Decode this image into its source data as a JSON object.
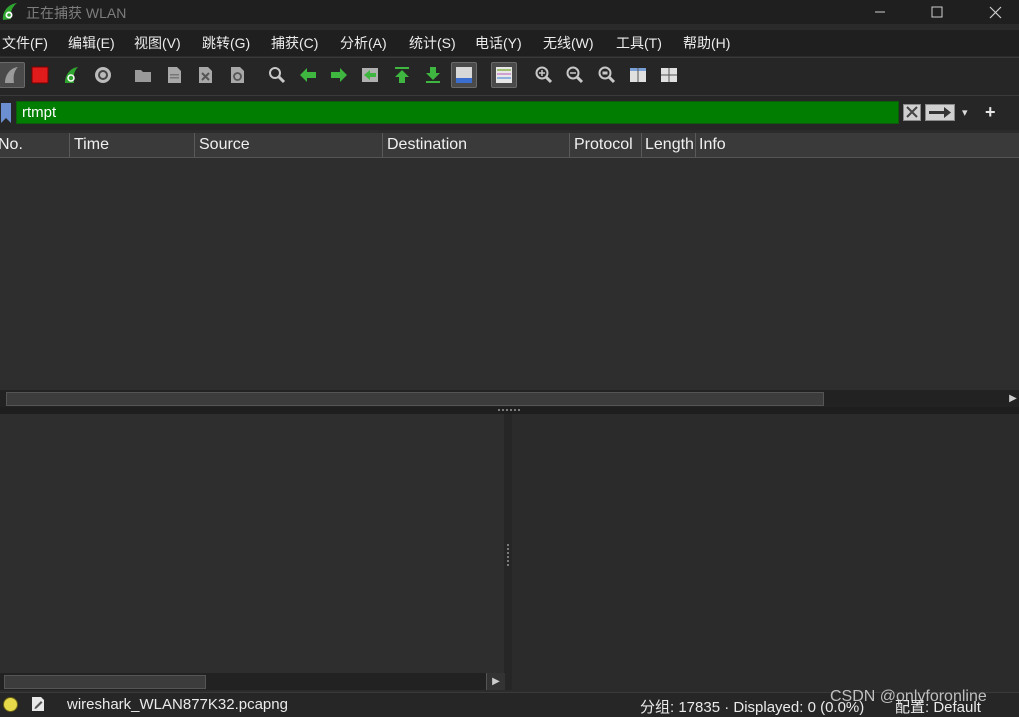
{
  "window": {
    "title": "正在捕获 WLAN"
  },
  "menu": [
    {
      "label": "文件(F)"
    },
    {
      "label": "编辑(E)"
    },
    {
      "label": "视图(V)"
    },
    {
      "label": "跳转(G)"
    },
    {
      "label": "捕获(C)"
    },
    {
      "label": "分析(A)"
    },
    {
      "label": "统计(S)"
    },
    {
      "label": "电话(Y)"
    },
    {
      "label": "无线(W)"
    },
    {
      "label": "工具(T)"
    },
    {
      "label": "帮助(H)"
    }
  ],
  "toolbar": {
    "icons": [
      "start-capture-icon",
      "stop-capture-icon",
      "restart-capture-icon",
      "capture-options-icon",
      "open-file-icon",
      "save-file-icon",
      "close-file-icon",
      "reload-file-icon",
      "find-packet-icon",
      "go-back-icon",
      "go-forward-icon",
      "go-to-packet-icon",
      "first-packet-icon",
      "last-packet-icon",
      "autoscroll-icon",
      "colorize-icon",
      "zoom-in-icon",
      "zoom-out-icon",
      "zoom-normal-icon",
      "resize-columns-icon",
      "expand-subtrees-icon"
    ]
  },
  "filter": {
    "value": "rtmpt",
    "background": "#017d01"
  },
  "packet_list": {
    "columns": [
      {
        "label": "No."
      },
      {
        "label": "Time"
      },
      {
        "label": "Source"
      },
      {
        "label": "Destination"
      },
      {
        "label": "Protocol"
      },
      {
        "label": "Length"
      },
      {
        "label": "Info"
      }
    ],
    "rows": []
  },
  "status": {
    "file": "wireshark_WLAN877K32.pcapng",
    "packets": "分组: 17835 · Displayed: 0 (0.0%)",
    "profile": "配置: Default",
    "led_color": "#e6d94a"
  },
  "watermark": "CSDN @onlyforonline"
}
